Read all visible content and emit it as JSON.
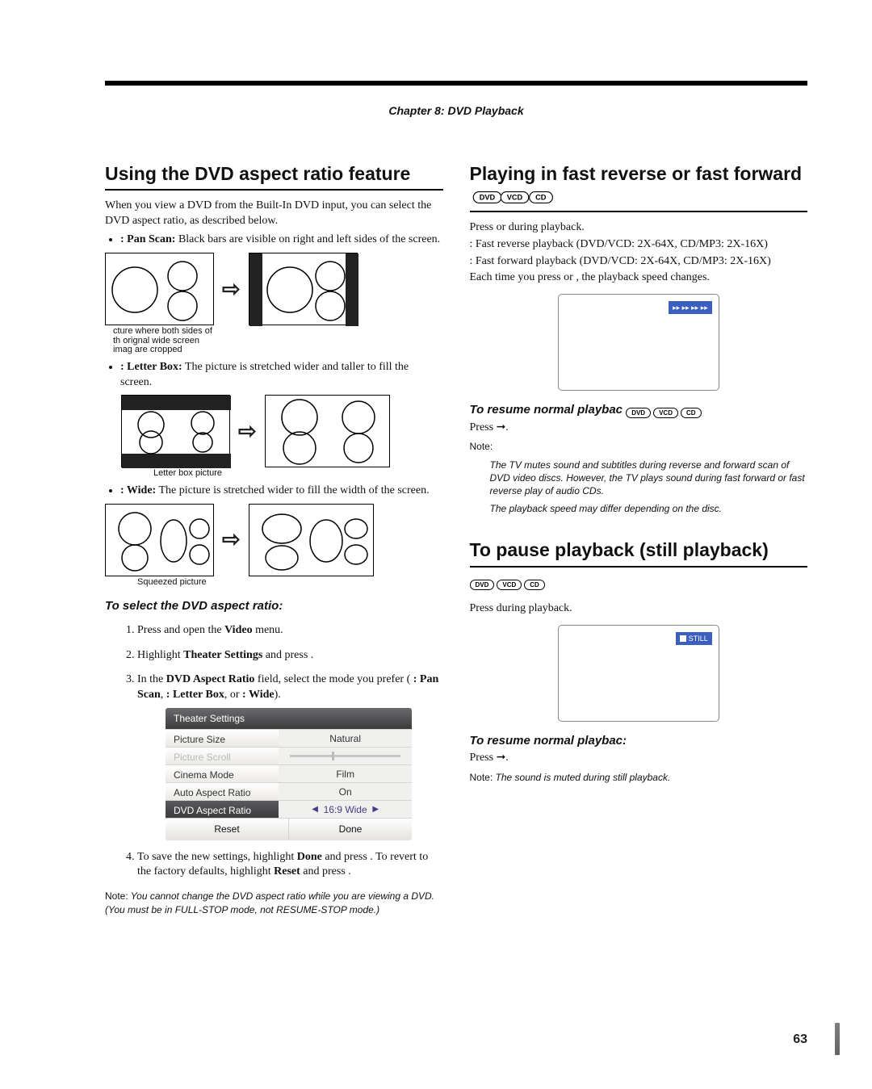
{
  "chapter": "Chapter 8: DVD Playback",
  "page_number": "63",
  "left": {
    "title": "Using the DVD aspect ratio feature",
    "intro": "When you view a DVD from the Built-In DVD input, you can select the DVD aspect ratio, as described below.",
    "pan_scan_label": ": Pan Scan:",
    "pan_scan_desc": " Black bars are visible on right and left sides of the screen.",
    "pan_scan_caption_l1": "cture where both sides of",
    "pan_scan_caption_l2": "th orignal wide screen",
    "pan_scan_caption_l3": "imag are cropped",
    "letter_box_label": ": Letter Box:",
    "letter_box_desc": " The picture is stretched wider and taller to fill the screen.",
    "letter_box_caption": "Letter box picture",
    "wide_label": ": Wide:",
    "wide_desc": " The picture is stretched wider to fill the width of the screen.",
    "wide_caption": "Squeezed picture",
    "select_heading": "To select the DVD aspect ratio:",
    "step1_a": "Press ",
    "step1_b": " and open the ",
    "step1_c": "Video",
    "step1_d": " menu.",
    "step2_a": "Highlight ",
    "step2_b": "Theater Settings",
    "step2_c": " and press ",
    "step2_d": ".",
    "step3_a": "In the ",
    "step3_b": "DVD Aspect Ratio",
    "step3_c": " field, select the mode you prefer (",
    "step3_d": ": Pan Scan",
    "step3_e": ", ",
    "step3_f": ": Letter Box",
    "step3_g": ", or ",
    "step3_h": ": Wide",
    "step3_i": ").",
    "step4_a": "To save the new settings, highlight ",
    "step4_b": "Done",
    "step4_c": " and press ",
    "step4_d": ". To revert to the factory defaults, highlight ",
    "step4_e": "Reset",
    "step4_f": " and press ",
    "step4_g": ".",
    "note_label": "Note:",
    "note_body": " You cannot change the DVD aspect ratio while you are viewing a DVD. (You must be in FULL-STOP mode, not RESUME-STOP mode.)",
    "settings": {
      "head": "Theater Settings",
      "rows": [
        {
          "lab": "Picture Size",
          "val": "Natural"
        },
        {
          "lab": "Picture Scroll",
          "val": ""
        },
        {
          "lab": "Cinema Mode",
          "val": "Film"
        },
        {
          "lab": "Auto Aspect Ratio",
          "val": "On"
        },
        {
          "lab": "DVD Aspect Ratio",
          "val": "16:9 Wide"
        }
      ],
      "reset": "Reset",
      "done": "Done"
    }
  },
  "right": {
    "title1": "Playing in fast reverse or fast forward",
    "p1_a": "Press ",
    "p1_b": " or ",
    "p1_c": " during playback.",
    "p2": ": Fast reverse playback (DVD/VCD: 2X-64X, CD/MP3: 2X-16X)",
    "p3": ": Fast forward playback (DVD/VCD: 2X-64X, CD/MP3: 2X-16X)",
    "p4_a": "Each time you press ",
    "p4_b": " or ",
    "p4_c": ", the playback speed changes.",
    "osd1": "▸▸ ▸▸ ▸▸ ▸▸",
    "resume1_heading": "To resume normal playbac",
    "resume1_a": "Press ",
    "resume1_b": "➞",
    "resume1_c": ".",
    "note_label": "Note:",
    "note1_body": "The TV mutes sound and subtitles during reverse and forward scan of DVD video discs. However, the TV plays sound during fast forward or fast reverse play of audio CDs.",
    "note1a_body": "The playback speed may differ depending on the disc.",
    "title2": "To pause playback (still playback)",
    "p5_a": "Press ",
    "p5_b": " during playback.",
    "osd2": "STILL",
    "resume2_heading": "To resume normal playbac:",
    "resume2_a": "Press ",
    "resume2_b": "➞",
    "resume2_c": ".",
    "note2_body": " The sound is muted during still playback."
  },
  "badges": {
    "dvd": "DVD",
    "vcd": "VCD",
    "cd": "CD"
  }
}
